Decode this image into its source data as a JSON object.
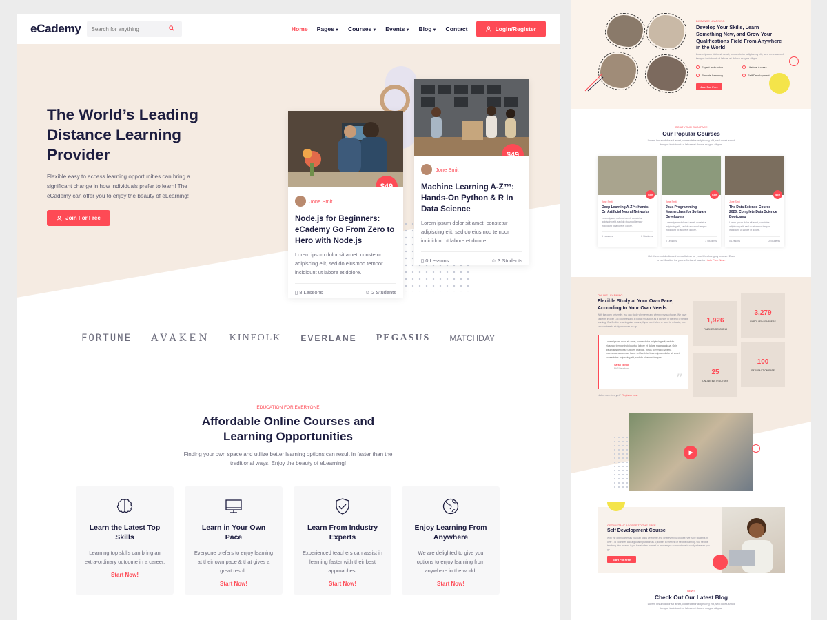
{
  "site": {
    "logo": "eCademy"
  },
  "search": {
    "placeholder": "Search for anything"
  },
  "nav": {
    "items": [
      {
        "label": "Home",
        "dropdown": false,
        "active": true
      },
      {
        "label": "Pages",
        "dropdown": true
      },
      {
        "label": "Courses",
        "dropdown": true
      },
      {
        "label": "Events",
        "dropdown": true
      },
      {
        "label": "Blog",
        "dropdown": true
      },
      {
        "label": "Contact",
        "dropdown": false
      }
    ],
    "login_label": "Login/Register"
  },
  "hero": {
    "title": "The World’s Leading Distance Learning Provider",
    "text": "Flexible easy to access learning opportunities can bring a significant change in how individuals prefer to learn! The eCademy can offer you to enjoy the beauty of eLearning!",
    "button": "Join For Free"
  },
  "hero_cards": [
    {
      "price": "$49",
      "author": "Jone Smit",
      "title": "Node.js for Beginners: eCademy Go From Zero to Hero with Node.js",
      "text": "Lorem ipsum dolor sit amet, constetur adipiscing elit, sed do eiusmod tempor incididunt ut labore et dolore.",
      "lessons": "8 Lessons",
      "students": "2 Students"
    },
    {
      "price": "$49",
      "author": "Jone Smit",
      "title": "Machine Learning A-Z™: Hands-On Python & R In Data Science",
      "text": "Lorem ipsum dolor sit amet, constetur adipiscing elit, sed do eiusmod tempor incididunt ut labore et dolore.",
      "lessons": "0 Lessons",
      "students": "3 Students"
    }
  ],
  "brands": [
    "FORTUNE",
    "AVAKEN",
    "KINFOLK",
    "EVERLANE",
    "PEGASUS",
    "MATCHDAY"
  ],
  "section": {
    "eyebrow": "EDUCATION FOR EVERYONE",
    "title_line1": "Affordable Online Courses and",
    "title_line2": "Learning Opportunities",
    "text": "Finding your own space and utilize better learning options can result in faster than the traditional ways. Enjoy the beauty of eLearning!"
  },
  "features": [
    {
      "icon": "brain-icon",
      "title": "Learn the Latest Top Skills",
      "text": "Learning top skills can bring an extra-ordinary outcome in a career.",
      "link": "Start Now!"
    },
    {
      "icon": "monitor-icon",
      "title": "Learn in Your Own Pace",
      "text": "Everyone prefers to enjoy learning at their own pace & that gives a great result.",
      "link": "Start Now!"
    },
    {
      "icon": "shield-check-icon",
      "title": "Learn From Industry Experts",
      "text": "Experienced teachers can assist in learning faster with their best approaches!",
      "link": "Start Now!"
    },
    {
      "icon": "globe-icon",
      "title": "Enjoy Learning From Anywhere",
      "text": "We are delighted to give you options to enjoy learning from anywhere in the world.",
      "link": "Start Now!"
    }
  ],
  "right": {
    "top": {
      "eyebrow": "DISTANCE LEARNING",
      "title": "Develop Your Skills, Learn Something New, and Grow Your Qualifications Field From Anywhere in the World",
      "text": "Lorem ipsum dolor sit amet, consectetur adipiscing elit, sed do eiusmod tempor incididunt ut labore et dolore magna aliqua.",
      "features": [
        "Expert Instruction",
        "Lifetime Access",
        "Remote Learning",
        "Self Development"
      ],
      "button": "Join For Free"
    },
    "popular": {
      "eyebrow": "GO AT YOUR OWN PACE",
      "title": "Our Popular Courses",
      "text": "Lorem ipsum dolor sit amet, consectetur adipiscing elit, sed do eiusmod tempor incididunt ut labore et dolore magna aliqua.",
      "cards": [
        {
          "price": "$59",
          "author": "Jone Smit",
          "title": "Deep Learning A-Z™: Hands-On Artificial Neural Networks",
          "text": "Lorem ipsum dolor sit amet, constetur adipiscing elit, sed do eiusmod tempor incididunt ut labore et dolore.",
          "lessons": "6 Lessons",
          "students": "2 Students"
        },
        {
          "price": "$49",
          "author": "Jone Smit",
          "title": "Java Programming Masterclass for Software Developers",
          "text": "Lorem ipsum dolor sit amet, constetur adipiscing elit, sed do eiusmod tempor incididunt ut labore et dolore.",
          "lessons": "0 Lessons",
          "students": "3 Students"
        },
        {
          "price": "$39",
          "author": "Jone Smit",
          "title": "The Data Science Course 2020: Complete Data Science Bootcamp",
          "text": "Lorem ipsum dolor sit amet, constetur adipiscing elit, sed do eiusmod tempor incididunt ut labore et dolore.",
          "lessons": "0 Lessons",
          "students": "2 Students"
        }
      ],
      "footer": "Get the most dedicated consultation for your life-changing course. Earn a certification for your effort and passion",
      "footer_link": "Join Free Now."
    },
    "flex": {
      "eyebrow": "ONLINE LEARNING",
      "title": "Flexible Study at Your Own Pace, According to Your Own Needs",
      "text": "With the open university, you can study whenever and wherever you choose. We have students in over 175 countries and a global reputation as a pioneer in the field of flexible learning. Our flexible teaching also means, if you travel often or need to relocate, you can continue to study wherever you go.",
      "quote": "Lorem ipsum dolor sit amet, consectetur adipiscing elit, sed do eiusmod tempor incididunt ut labore et dolore magna aliqua. Quis ipsum suspendisse ultrices gravida. Risus commodo viverra maecenas accumsan lacus vel facilisis. Lorem ipsum dolor sit amet, consectetur adipiscing elit, sed do eiusmod tempor.",
      "quote_name": "Sarah Taylor",
      "quote_role": "PHP Developer",
      "member_text": "Not a member yet?",
      "member_link": "Register now",
      "stats": [
        {
          "number": "1,926",
          "label": "FINISHED SESSIONS"
        },
        {
          "number": "3,279",
          "label": "ENROLLED LEARNERS"
        },
        {
          "number": "25",
          "label": "ONLINE INSTRUCTORS"
        },
        {
          "number": "100",
          "label": "SATISFACTION RATE"
        }
      ]
    },
    "self": {
      "eyebrow": "GET INSTANT ACCESS TO THE FREE",
      "title": "Self Development Course",
      "text": "With the open university you can study whenever and wherever you choose. We have students in over 175 countries and a global reputation as a pioneer in the field of flexible learning. Our flexible teaching also means, if you travel often or need to relocate you can continue to study wherever you go.",
      "button": "Start For Free"
    },
    "blog": {
      "eyebrow": "NEWS",
      "title": "Check Out Our Latest Blog",
      "text": "Lorem ipsum dolor sit amet, consectetur adipiscing elit, sed do eiusmod tempor incididunt ut labore et dolore magna aliqua."
    }
  },
  "colors": {
    "accent": "#fe4a55",
    "hero_bg": "#f5ebe2",
    "dark": "#1d1d3f"
  }
}
